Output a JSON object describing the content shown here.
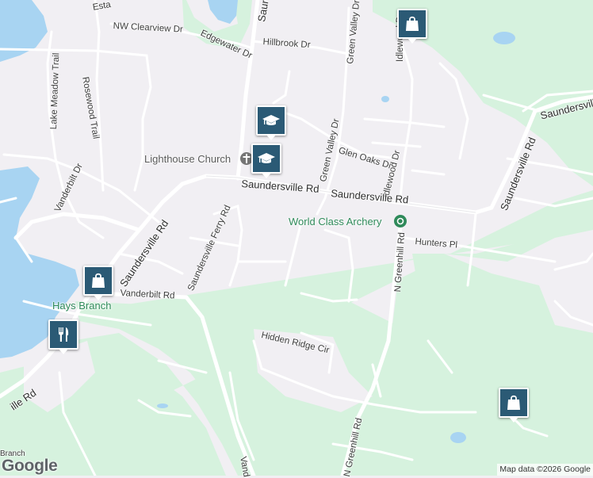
{
  "map": {
    "roads": {
      "saundersville_main": "Saundersville Rd",
      "saundersville_main_2": "Saundersville Rd",
      "saundersville_diag": "Saundersville Rd",
      "saundersville_top": "Saundersville Rd",
      "saundersville_east": "Saundersville Rd",
      "saundersville_northeast": "Saundersville Rd",
      "saundersville_ferry": "Saundersville Ferry Rd",
      "clearview": "NW Clearview Dr",
      "edgewater": "Edgewater Dr",
      "hillbrook": "Hillbrook Dr",
      "green_valley_top": "Green Valley Dr",
      "green_valley": "Green Valley Dr",
      "glen_oaks": "Glen Oaks Dr",
      "idlewood_top": "Idlewood Dr",
      "idlewood": "Idlewood Dr",
      "lake_meadow": "Lake Meadow Trail",
      "rosewood": "Rosewood Trail",
      "vanderbilt_dr": "Vanderbilt Dr",
      "vanderbilt_rd": "Vanderbilt Rd",
      "hunters": "Hunters Pl",
      "n_greenhill": "N Greenhill Rd",
      "n_greenhill_2": "N Greenhill Rd",
      "hidden_ridge": "Hidden Ridge Cir",
      "vand_bottom": "Vand",
      "est_top": "Esta",
      "southwest_rd": "ille Rd",
      "branch_label": "Branch"
    },
    "pois": {
      "lighthouse_church": "Lighthouse Church",
      "world_class_archery": "World Class Archery",
      "hays_branch": "Hays Branch"
    },
    "markers": [
      {
        "id": "school-1",
        "icon": "graduation-cap-icon"
      },
      {
        "id": "school-2",
        "icon": "graduation-cap-icon"
      },
      {
        "id": "shopping-1",
        "icon": "shopping-bag-icon"
      },
      {
        "id": "shopping-2",
        "icon": "shopping-bag-icon"
      },
      {
        "id": "shopping-3",
        "icon": "shopping-bag-icon"
      },
      {
        "id": "restaurant-1",
        "icon": "fork-knife-icon"
      }
    ],
    "colors": {
      "land": "#f1eff3",
      "park": "#d6f2de",
      "water": "#a8d4f2",
      "road": "#ffffff",
      "marker": "#2b5a75",
      "poi_green": "#2f8a5a"
    }
  },
  "footer": {
    "logo": "Google",
    "attribution": "Map data ©2026 Google"
  }
}
